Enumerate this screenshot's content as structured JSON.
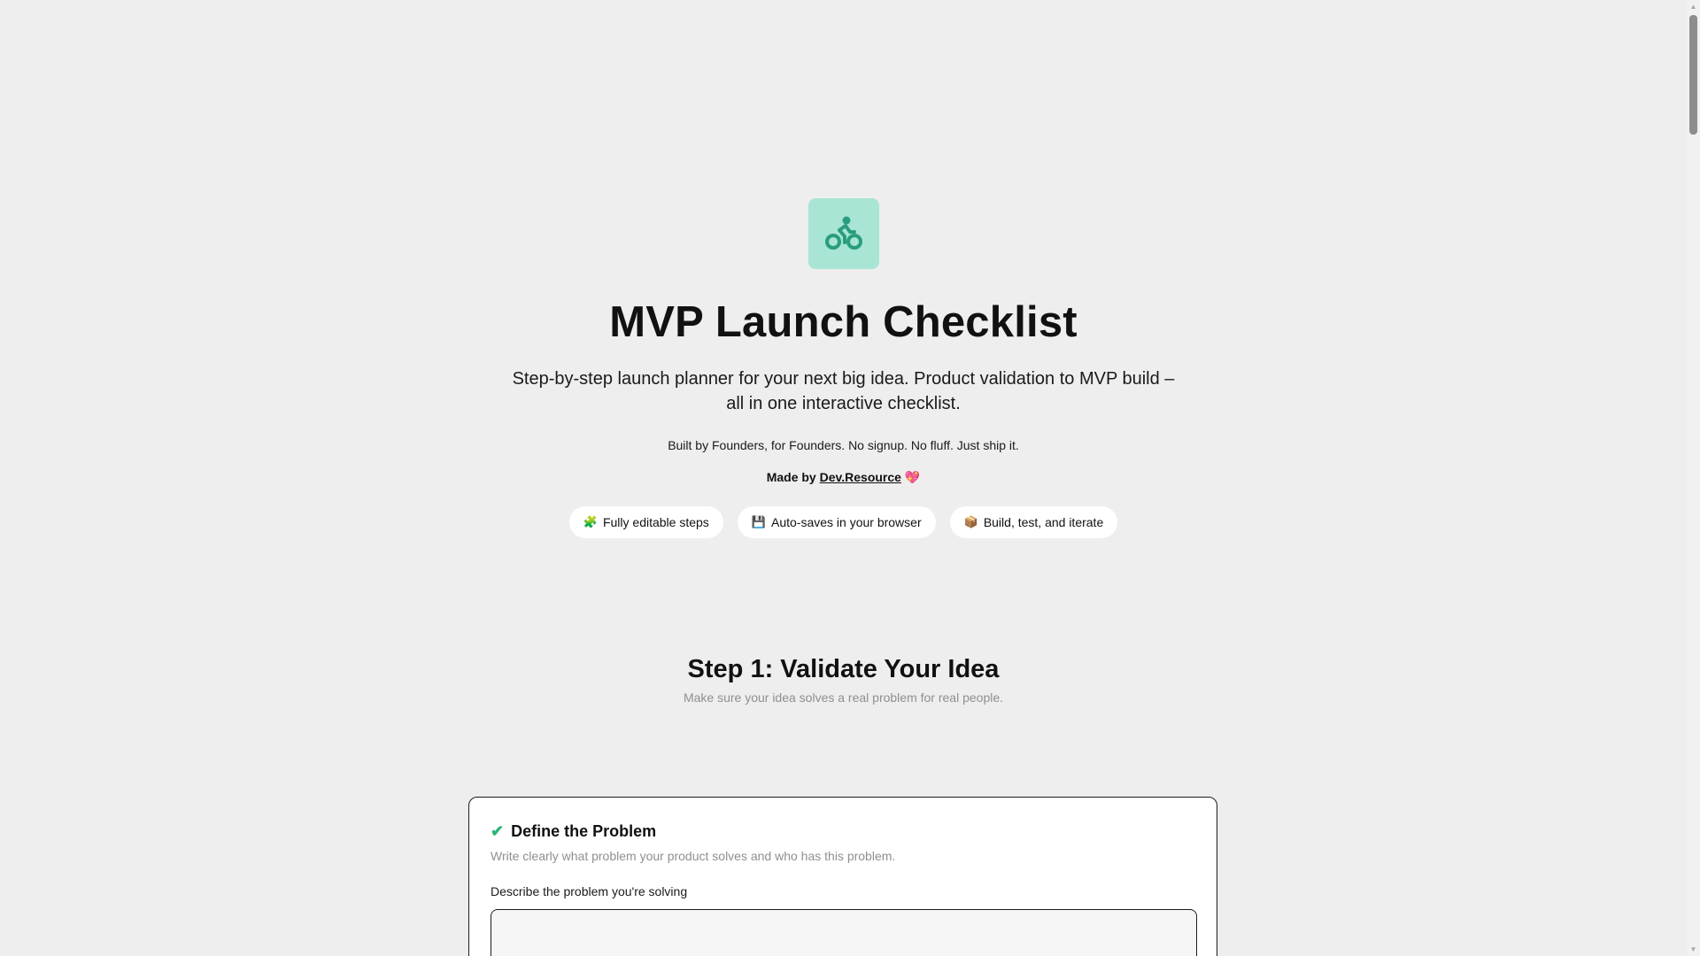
{
  "hero": {
    "logo_icon": "bicycle-rider-icon",
    "logo_bg": "#a8e5d5",
    "logo_fg": "#2a9d7f",
    "title": "MVP Launch Checklist",
    "subtitle": "Step-by-step launch planner for your next big idea. Product validation to MVP build – all in one interactive checklist.",
    "tagline": "Built by Founders, for Founders. No signup. No fluff. Just ship it.",
    "made_by_prefix": "Made by",
    "made_by_link": "Dev.Resource",
    "made_by_suffix": "💖"
  },
  "features": [
    {
      "emoji": "🧩",
      "label": "Fully editable steps"
    },
    {
      "emoji": "💾",
      "label": "Auto-saves in your browser"
    },
    {
      "emoji": "📦",
      "label": "Build, test, and iterate"
    }
  ],
  "step": {
    "title": "Step 1: Validate Your Idea",
    "description": "Make sure your idea solves a real problem for real people."
  },
  "card": {
    "check_icon": "✔",
    "check_color": "#2bb673",
    "title": "Define the Problem",
    "description": "Write clearly what problem your product solves and who has this problem.",
    "field_label": "Describe the problem you're solving",
    "field_value": ""
  }
}
